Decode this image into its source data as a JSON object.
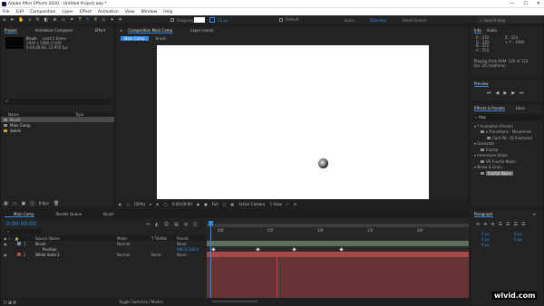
{
  "window": {
    "title": "Adobe After Effects 2020 - Untitled Project.aep *",
    "controls": [
      "—",
      "☐",
      "✕"
    ]
  },
  "menu": [
    "File",
    "Edit",
    "Composition",
    "Layer",
    "Effect",
    "Animation",
    "View",
    "Window",
    "Help"
  ],
  "toolbar": {
    "snapping_label": "Snapping",
    "stroke_value": "25 px",
    "workspaces": [
      "Default",
      "Learn",
      "Standard",
      "Small Screen"
    ],
    "search_placeholder": "Search Help"
  },
  "project": {
    "tabs": [
      "Project",
      "Animation Composer",
      "Effect"
    ],
    "selected_name": "Brush",
    "selected_info": [
      "used 2 times",
      "1920 x 1080 (1.00)",
      "0:00:00:00, 23.976 fps"
    ],
    "search_glyph": "⌕",
    "columns": [
      "Name",
      "Type"
    ],
    "items": [
      {
        "name": "Brush",
        "selected": true,
        "color": "#8a8a8a"
      },
      {
        "name": "Main Comp",
        "selected": false,
        "color": "#8a8a8a"
      },
      {
        "name": "Solids",
        "selected": false,
        "color": "#c9a441"
      }
    ],
    "footer_depth": "8 bpc"
  },
  "viewer": {
    "tabs": [
      "Composition Main Comp",
      "Layer (none)"
    ],
    "subtabs": [
      "Main Comp",
      "Brush"
    ],
    "zoom": "(50%)",
    "timecode": "0:00:00:00",
    "resolution": "Full",
    "camera": "Active Camera",
    "views": "1 View"
  },
  "info": {
    "tabs": [
      "Info",
      "Audio"
    ],
    "rgb": [
      "R : 255",
      "G : 255",
      "B : 255",
      "A : 255"
    ],
    "xy": [
      "X : 524",
      "+ Y : 1000"
    ],
    "playing": "Playing from RAM: 105 of 123",
    "fps": "fps: 25 (realtime)"
  },
  "preview": {
    "title": "Preview",
    "controls": [
      "⏮",
      "◀",
      "▶",
      "▶",
      "⏭"
    ]
  },
  "effects": {
    "tabs": [
      "Effects & Presets",
      "Libra"
    ],
    "search": "frac",
    "tree": [
      {
        "text": "▾ * Animation Presets",
        "level": 0,
        "highlight": false
      },
      {
        "text": "▾ Transitions - Movement",
        "level": 1,
        "highlight": false
      },
      {
        "text": "Card Wi...ID Fractured",
        "level": 2,
        "highlight": false
      },
      {
        "text": "▾ Generate",
        "level": 0,
        "highlight": false
      },
      {
        "text": "Fractal",
        "level": 1,
        "highlight": false
      },
      {
        "text": "▾ Immersive Video",
        "level": 0,
        "highlight": false
      },
      {
        "text": "VR Fractal Noise",
        "level": 1,
        "highlight": false
      },
      {
        "text": "▾ Noise & Grain",
        "level": 0,
        "highlight": false
      },
      {
        "text": "Fractal Noise",
        "level": 1,
        "highlight": true
      }
    ]
  },
  "timeline": {
    "tabs": [
      "Main Comp",
      "Render Queue",
      "Brush"
    ],
    "timecode": "0:00:00:00",
    "search_glyph": "⌕",
    "columns": [
      "Source Name",
      "Mode",
      "T TrkMat",
      "Parent"
    ],
    "layers": [
      {
        "num": "1",
        "name": "Brush",
        "mode": "Normal",
        "trk": "",
        "parent": "None",
        "color": "#6e8ea8"
      },
      {
        "num": "",
        "name": "Position",
        "mode": "",
        "trk": "",
        "parent": "",
        "value": "960.0,540.0",
        "color": ""
      },
      {
        "num": "2",
        "name": "White Solid 1",
        "mode": "Normal",
        "trk": "None",
        "parent": "None",
        "color": "#a84848"
      }
    ],
    "ruler": [
      "00f",
      "05f",
      "10f",
      "15f",
      "20f"
    ],
    "footer": "Toggle Switches / Modes",
    "keyframes": [
      0.02,
      0.19,
      0.33,
      0.51
    ]
  },
  "paragraph": {
    "tabs": [
      "Paragraph",
      "≡"
    ],
    "fields": [
      "0 px",
      "0 px",
      "0 px",
      "0 px",
      "0 px"
    ]
  },
  "watermark": "wlvid.com",
  "colors": {
    "accent": "#2d8ceb",
    "panel": "#232323",
    "header": "#1d1d1d",
    "workspace_active": "#2d8ceb"
  }
}
